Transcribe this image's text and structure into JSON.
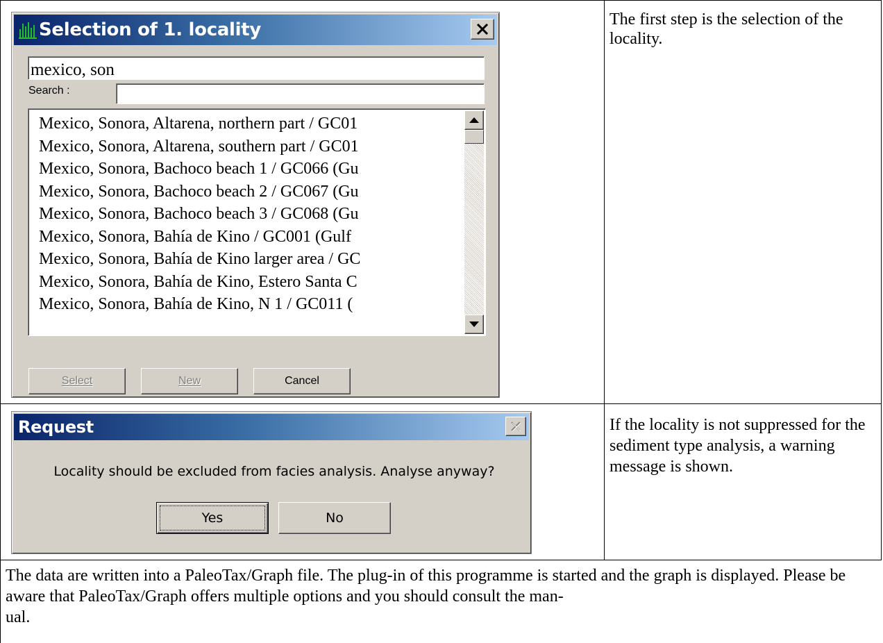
{
  "selection_dialog": {
    "title": "Selection of 1. locality",
    "locality_value": "mexico, son",
    "search_label": "Search :",
    "search_value": "",
    "list_items": [
      "Mexico, Sonora, Altarena, northern part / GC01",
      "Mexico, Sonora, Altarena, southern part / GC01",
      "Mexico, Sonora, Bachoco beach 1 / GC066 (Gu",
      "Mexico, Sonora, Bachoco beach 2 / GC067 (Gu",
      "Mexico, Sonora, Bachoco beach 3 / GC068 (Gu",
      "Mexico, Sonora, Bahía de Kino / GC001 (Gulf",
      "Mexico, Sonora, Bahía de Kino larger area / GC",
      "Mexico, Sonora, Bahía de Kino, Estero Santa C",
      "Mexico, Sonora, Bahía de Kino, N 1 / GC011 ("
    ],
    "select_label": "Select",
    "new_label": "New",
    "cancel_label": "Cancel"
  },
  "request_dialog": {
    "title": "Request",
    "message": "Locality should be excluded from facies analysis. Analyse anyway?",
    "yes_label": "Yes",
    "no_label": "No"
  },
  "captions": {
    "step1": "The first step is the selection of the locality.",
    "step2": "If the locality is not suppressed for the sediment type analysis, a warning message is shown.",
    "step3": "The data are written into a PaleoTax/Graph file. The plug-in of this programme is started and the graph is displayed. Please be aware that PaleoTax/Graph offers multiple options and you should consult the man-ual."
  },
  "colors": {
    "titlebar_start": "#0a246a",
    "titlebar_end": "#a6caf0",
    "dialog_face": "#d4d0c8"
  },
  "icons": {
    "app": "paleotax-icon",
    "close": "close-icon",
    "scroll_up": "scroll-up-icon",
    "scroll_down": "scroll-down-icon"
  }
}
